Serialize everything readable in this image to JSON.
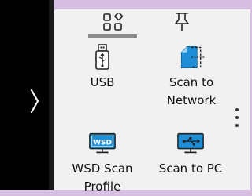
{
  "tabs": [
    {
      "icon": "apps-grid-icon",
      "active": true
    },
    {
      "icon": "pushpin-icon",
      "active": false
    }
  ],
  "tiles": [
    {
      "label": "USB",
      "icon": "usb-drive-icon"
    },
    {
      "label": "Scan to\nNetwork",
      "icon": "scan-to-network-icon"
    },
    {
      "label": "WSD Scan\nProfile",
      "icon": "wsd-icon",
      "badge": "WSD"
    },
    {
      "label": "Scan to PC",
      "icon": "scan-to-pc-icon"
    }
  ],
  "colors": {
    "background": "#d6bfe0",
    "panel": "#f1f1f1",
    "accent_blue": "#1e8fd6",
    "active_tab": "#8c8c8c"
  }
}
